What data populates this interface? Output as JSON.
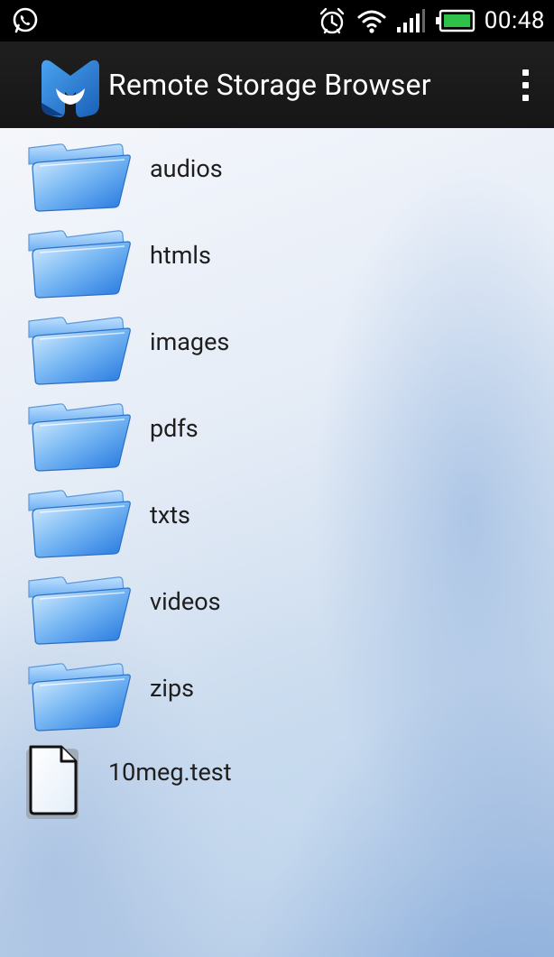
{
  "status_bar": {
    "left_icon": "whatsapp-icon",
    "icons": [
      "alarm-clock-icon",
      "wifi-icon",
      "signal-icon",
      "battery-icon"
    ],
    "time": "00:48"
  },
  "action_bar": {
    "logo_icon": "malwarebytes-logo-icon",
    "title": "Remote Storage Browser",
    "overflow_icon": "overflow-menu-icon"
  },
  "files": [
    {
      "name": "audios",
      "type": "folder"
    },
    {
      "name": "htmls",
      "type": "folder"
    },
    {
      "name": "images",
      "type": "folder"
    },
    {
      "name": "pdfs",
      "type": "folder"
    },
    {
      "name": "txts",
      "type": "folder"
    },
    {
      "name": "videos",
      "type": "folder"
    },
    {
      "name": "zips",
      "type": "folder"
    },
    {
      "name": "10meg.test",
      "type": "file"
    }
  ],
  "colors": {
    "status_bar": "#000000",
    "action_bar": "#1a1a1a",
    "folder_blue": "#3f8fe6",
    "text": "#1e1e1e"
  }
}
